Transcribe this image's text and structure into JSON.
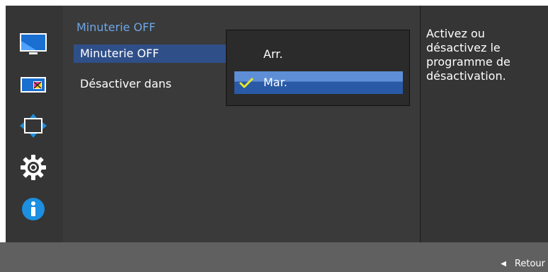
{
  "menu": {
    "title": "Minuterie OFF",
    "items": [
      {
        "label": "Minuterie OFF",
        "selected": true
      },
      {
        "label": "Désactiver dans",
        "selected": false
      }
    ]
  },
  "dropdown": {
    "options": [
      {
        "label": "Arr.",
        "selected": false
      },
      {
        "label": "Mar.",
        "selected": true
      }
    ]
  },
  "help": {
    "text": "Activez ou désactivez le programme de désactivation."
  },
  "footer": {
    "back_label": "Retour"
  },
  "side_icons": [
    "picture-icon",
    "color-icon",
    "size-position-icon",
    "settings-gear-icon",
    "info-icon"
  ],
  "colors": {
    "accent_text": "#6ea6e6",
    "highlight": "#2f4f88",
    "checkmark": "#e5e82a",
    "info_icon": "#1c8fe0"
  }
}
